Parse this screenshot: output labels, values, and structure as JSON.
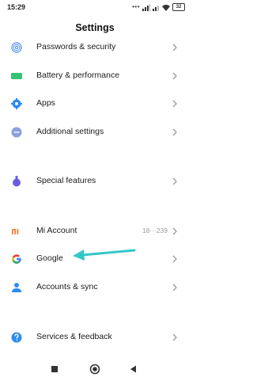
{
  "status_bar": {
    "time": "15:29",
    "battery_level": "32"
  },
  "header": {
    "title": "Settings"
  },
  "rows": [
    {
      "label": "Passwords & security",
      "icon": "fingerprint-icon",
      "color": "#4a8df6"
    },
    {
      "label": "Battery & performance",
      "icon": "battery-icon",
      "color": "#35c276"
    },
    {
      "label": "Apps",
      "icon": "gear-icon",
      "color": "#2d8cf0"
    },
    {
      "label": "Additional settings",
      "icon": "more-dots-icon",
      "color": "#8e9fe0"
    },
    {
      "label": "Special features",
      "icon": "flask-icon",
      "color": "#6a5ee0"
    },
    {
      "label": "Mi Account",
      "icon": "mi-logo-icon",
      "color": "#f07d32",
      "value": "18···239"
    },
    {
      "label": "Google",
      "icon": "google-g-icon",
      "color": "#4285f4"
    },
    {
      "label": "Accounts & sync",
      "icon": "person-icon",
      "color": "#2d8cf0"
    },
    {
      "label": "Services & feedback",
      "icon": "help-icon",
      "color": "#2d8cf0"
    }
  ],
  "annotation": {
    "arrow_color": "#33c8c8"
  }
}
